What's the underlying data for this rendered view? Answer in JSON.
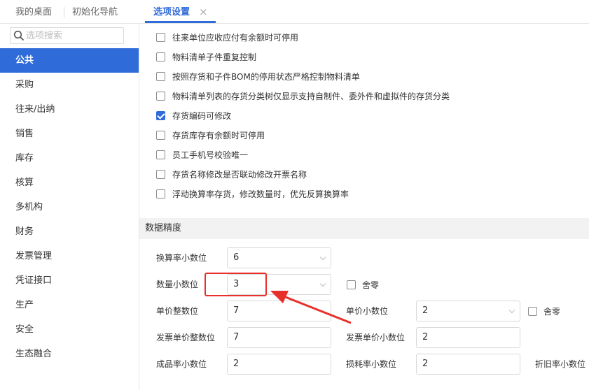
{
  "tabs": [
    {
      "label": "我的桌面"
    },
    {
      "label": "初始化导航"
    },
    {
      "label": "选项设置",
      "active": true
    }
  ],
  "tab_close_glyph": "×",
  "sidebar": {
    "search_placeholder": "选项搜索",
    "items": [
      {
        "label": "公共",
        "active": true
      },
      {
        "label": "采购"
      },
      {
        "label": "往来/出纳"
      },
      {
        "label": "销售"
      },
      {
        "label": "库存"
      },
      {
        "label": "核算"
      },
      {
        "label": "多机构"
      },
      {
        "label": "财务"
      },
      {
        "label": "发票管理"
      },
      {
        "label": "凭证接口"
      },
      {
        "label": "生产"
      },
      {
        "label": "安全"
      },
      {
        "label": "生态融合"
      }
    ]
  },
  "options": [
    {
      "label": "往来单位应收应付有余额时可停用",
      "checked": false
    },
    {
      "label": "物料清单子件重复控制",
      "checked": false
    },
    {
      "label": "按照存货和子件BOM的停用状态严格控制物料清单",
      "checked": false
    },
    {
      "label": "物料清单列表的存货分类树仅显示支持自制件、委外件和虚拟件的存货分类",
      "checked": false
    },
    {
      "label": "存货编码可修改",
      "checked": true
    },
    {
      "label": "存货库存有余额时可停用",
      "checked": false
    },
    {
      "label": "员工手机号校验唯一",
      "checked": false
    },
    {
      "label": "存货名称修改是否联动修改开票名称",
      "checked": false
    },
    {
      "label": "浮动换算率存货，修改数量时，优先反算换算率",
      "checked": false
    }
  ],
  "precision": {
    "title": "数据精度",
    "exchange_rate_decimals": {
      "label": "换算率小数位",
      "value": "6"
    },
    "quantity_decimals": {
      "label": "数量小数位",
      "value": "3"
    },
    "quantity_rounding": {
      "label": "舍零",
      "checked": false
    },
    "unit_price_integers": {
      "label": "单价整数位",
      "value": "7"
    },
    "unit_price_decimals": {
      "label": "单价小数位",
      "value": "2"
    },
    "unit_price_rounding": {
      "label": "舍零",
      "checked": false
    },
    "invoice_unit_price_integers": {
      "label": "发票单价整数位",
      "value": "7"
    },
    "invoice_unit_price_decimals": {
      "label": "发票单价小数位",
      "value": "2"
    },
    "yield_rate_decimals": {
      "label": "成品率小数位",
      "value": "2"
    },
    "loss_rate_decimals": {
      "label": "损耗率小数位",
      "value": "2"
    },
    "depreciation_rate_decimals": {
      "label": "折旧率小数位"
    }
  },
  "colors": {
    "accent": "#2f6bd9",
    "annotation": "#e8302a",
    "section_bg": "#f2f2f2"
  }
}
